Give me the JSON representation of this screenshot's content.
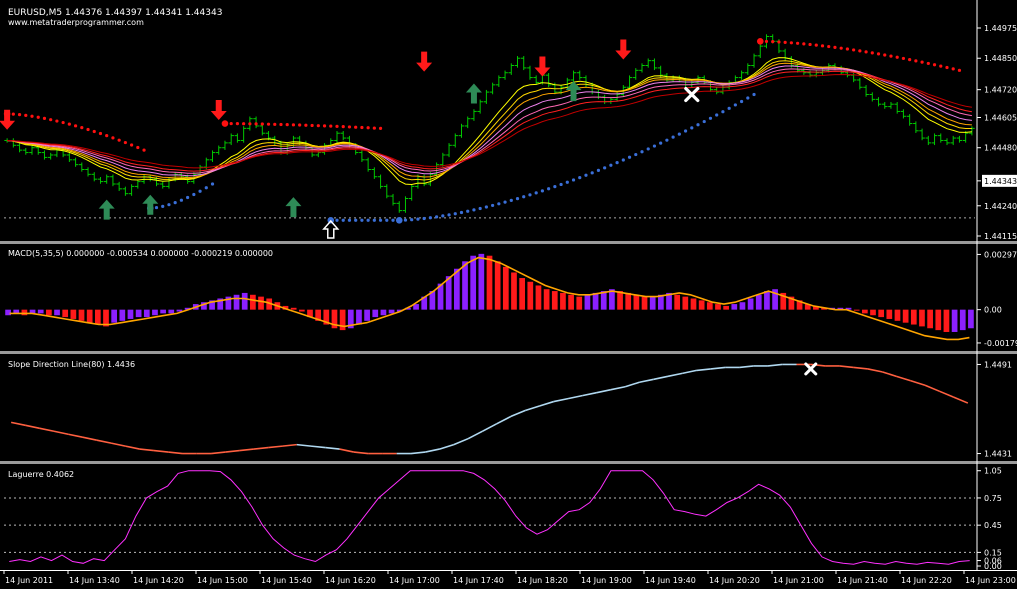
{
  "header": {
    "symbol_line": "EURUSD,M5  1.44376 1.44397 1.44341 1.44343",
    "watermark": "www.metatraderprogrammer.com"
  },
  "colors": {
    "background": "#000000",
    "bull_candle": "#00c800",
    "ma_colors": [
      "#ffff00",
      "#ffd700",
      "#ffa500",
      "#ee82ee",
      "#ff69b4",
      "#ff2020",
      "#c00000"
    ],
    "sar_red": "#ff1010",
    "sar_blue": "#3a6fd8",
    "up_arrow": "#2e8b57",
    "down_arrow": "#ff1a1a",
    "macd_up": "#8b20ff",
    "macd_down": "#ff1a1a",
    "macd_signal": "#ffa500",
    "slope_up": "#b0d8f0",
    "slope_down": "#ff6040",
    "laguerre": "#ff30ff",
    "cross_marker": "#ffffff"
  },
  "icons": {
    "buy_signal": "green-up-arrow-icon",
    "sell_signal": "red-down-arrow-icon",
    "exit": "white-x-icon",
    "entry": "white-hollow-up-arrow-icon"
  },
  "chart_data": [
    {
      "type": "line",
      "title": "EURUSD,M5  1.44376 1.44397 1.44341 1.44343",
      "ylim": [
        1.44115,
        1.44975
      ],
      "y_ticks": [
        "1.44975",
        "1.44850",
        "1.44720",
        "1.44605",
        "1.44480",
        "1.44343",
        "1.44240",
        "1.44115"
      ],
      "current_price": "1.44343",
      "series": [],
      "close": [
        1.4451,
        1.4449,
        1.4447,
        1.4446,
        1.4448,
        1.4446,
        1.4444,
        1.4445,
        1.4447,
        1.4445,
        1.4443,
        1.4441,
        1.4439,
        1.4437,
        1.4435,
        1.4434,
        1.4436,
        1.4433,
        1.4431,
        1.4429,
        1.4432,
        1.4434,
        1.4436,
        1.4435,
        1.4433,
        1.4432,
        1.4435,
        1.4437,
        1.4436,
        1.4434,
        1.4437,
        1.444,
        1.4443,
        1.4446,
        1.4448,
        1.445,
        1.4453,
        1.4451,
        1.4456,
        1.446,
        1.4457,
        1.4454,
        1.4452,
        1.445,
        1.4446,
        1.4449,
        1.4452,
        1.445,
        1.4448,
        1.4445,
        1.4446,
        1.4449,
        1.4451,
        1.4454,
        1.4452,
        1.4449,
        1.4446,
        1.4443,
        1.4439,
        1.4436,
        1.4432,
        1.4428,
        1.4425,
        1.4422,
        1.4427,
        1.4432,
        1.4436,
        1.4433,
        1.4437,
        1.4441,
        1.4445,
        1.4449,
        1.4453,
        1.4457,
        1.446,
        1.4463,
        1.4467,
        1.4471,
        1.4474,
        1.4477,
        1.4479,
        1.4482,
        1.4485,
        1.4481,
        1.4477,
        1.4475,
        1.4478,
        1.4474,
        1.4471,
        1.4473,
        1.4476,
        1.4479,
        1.4477,
        1.4474,
        1.4471,
        1.4469,
        1.4467,
        1.4468,
        1.447,
        1.4473,
        1.4477,
        1.448,
        1.4482,
        1.4484,
        1.4481,
        1.4478,
        1.4476,
        1.4477,
        1.4476,
        1.4474,
        1.4475,
        1.4477,
        1.4475,
        1.4472,
        1.4471,
        1.4473,
        1.4475,
        1.4477,
        1.4479,
        1.4482,
        1.4486,
        1.449,
        1.4494,
        1.4492,
        1.4488,
        1.4485,
        1.4482,
        1.448,
        1.4479,
        1.4478,
        1.4479,
        1.448,
        1.4482,
        1.4481,
        1.4479,
        1.4478,
        1.4476,
        1.4473,
        1.447,
        1.4468,
        1.4466,
        1.4465,
        1.4466,
        1.4463,
        1.4461,
        1.4458,
        1.4455,
        1.4452,
        1.445,
        1.4453,
        1.4451,
        1.445,
        1.4452,
        1.4451,
        1.4454,
        1.4456
      ],
      "buy_arrows": [
        [
          16,
          1.4422
        ],
        [
          23,
          1.4424
        ],
        [
          46,
          1.4423
        ],
        [
          75,
          1.447
        ],
        [
          91,
          1.4471
        ]
      ],
      "sell_arrows": [
        [
          0,
          1.446
        ],
        [
          34,
          1.4464
        ],
        [
          67,
          1.4484
        ],
        [
          86,
          1.4482
        ],
        [
          99,
          1.4489
        ]
      ],
      "entry_marker": [
        52,
        1.4414
      ],
      "exit_marker": [
        110,
        1.447
      ]
    },
    {
      "type": "bar",
      "title": "MACD(5,35,5) 0.000000 -0.000534 0.000000 -0.000219 0.000000",
      "ylim": [
        -0.0019,
        0.0031
      ],
      "y_ticks": [
        "0.00297",
        "0.00",
        "-0.00179"
      ],
      "histogram": [
        -0.0003,
        -0.0002,
        -0.0003,
        -0.0002,
        -0.0002,
        -0.0003,
        -0.0003,
        -0.0004,
        -0.0005,
        -0.0006,
        -0.0007,
        -0.0008,
        -0.0009,
        -0.0007,
        -0.0006,
        -0.0005,
        -0.0004,
        -0.0004,
        -0.0003,
        -0.0002,
        -0.0002,
        -0.0001,
        0.0001,
        0.0003,
        0.0004,
        0.0005,
        0.0006,
        0.0007,
        0.0008,
        0.0009,
        0.0008,
        0.0007,
        0.0006,
        0.0004,
        0.0002,
        0.0001,
        -0.0001,
        -0.0004,
        -0.0006,
        -0.0008,
        -0.001,
        -0.0011,
        -0.001,
        -0.0008,
        -0.0006,
        -0.0004,
        -0.0003,
        -0.0002,
        -0.0001,
        0.0001,
        0.0003,
        0.0007,
        0.001,
        0.0014,
        0.0018,
        0.0022,
        0.0026,
        0.0029,
        0.003,
        0.0029,
        0.0026,
        0.0023,
        0.002,
        0.0017,
        0.0015,
        0.0013,
        0.0011,
        0.001,
        0.0009,
        0.0008,
        0.0007,
        0.0008,
        0.0009,
        0.001,
        0.0011,
        0.001,
        0.0009,
        0.0008,
        0.0007,
        0.0007,
        0.0008,
        0.0009,
        0.0008,
        0.0007,
        0.0006,
        0.0005,
        0.0004,
        0.0003,
        0.0002,
        0.0003,
        0.0004,
        0.0006,
        0.0008,
        0.001,
        0.0011,
        0.0009,
        0.0007,
        0.0005,
        0.0003,
        0.0002,
        0.0001,
        0.0001,
        0.0001,
        0.0001,
        0.0,
        -0.0002,
        -0.0003,
        -0.0004,
        -0.0005,
        -0.0006,
        -0.0007,
        -0.0008,
        -0.0009,
        -0.001,
        -0.0011,
        -0.0012,
        -0.0012,
        -0.0011,
        -0.001
      ],
      "signal": [
        -0.0002,
        -0.0002,
        -0.0002,
        -0.0003,
        -0.0004,
        -0.0005,
        -0.0006,
        -0.0007,
        -0.0008,
        -0.0008,
        -0.0007,
        -0.0006,
        -0.0005,
        -0.0004,
        -0.0003,
        -0.0002,
        0.0,
        0.0002,
        0.0004,
        0.0005,
        0.0006,
        0.0006,
        0.0005,
        0.0004,
        0.0002,
        0.0,
        -0.0002,
        -0.0004,
        -0.0006,
        -0.0008,
        -0.0009,
        -0.0008,
        -0.0007,
        -0.0005,
        -0.0003,
        -0.0001,
        0.0002,
        0.0006,
        0.001,
        0.0015,
        0.002,
        0.0025,
        0.0028,
        0.0027,
        0.0025,
        0.0022,
        0.0019,
        0.0016,
        0.0013,
        0.0011,
        0.0009,
        0.0008,
        0.0008,
        0.0009,
        0.001,
        0.0009,
        0.0008,
        0.0007,
        0.0007,
        0.0008,
        0.0009,
        0.0008,
        0.0006,
        0.0004,
        0.0003,
        0.0004,
        0.0006,
        0.0008,
        0.001,
        0.0008,
        0.0006,
        0.0004,
        0.0002,
        0.0001,
        0.0,
        0.0,
        -0.0002,
        -0.0004,
        -0.0006,
        -0.0008,
        -0.001,
        -0.0012,
        -0.0014,
        -0.0015,
        -0.0016,
        -0.0016,
        -0.0015
      ]
    },
    {
      "type": "line",
      "title": "Slope Direction Line(80) 1.4436",
      "ylim": [
        1.4428,
        1.4494
      ],
      "y_ticks": [
        "1.4491",
        "1.4431"
      ],
      "values": [
        1.4452,
        1.445,
        1.4448,
        1.4446,
        1.4444,
        1.4442,
        1.444,
        1.4438,
        1.4436,
        1.4434,
        1.4433,
        1.4432,
        1.4431,
        1.4431,
        1.4431,
        1.4432,
        1.4433,
        1.4434,
        1.4435,
        1.4436,
        1.4437,
        1.4436,
        1.4435,
        1.4434,
        1.4432,
        1.4431,
        1.4431,
        1.4431,
        1.4431,
        1.4432,
        1.4434,
        1.4437,
        1.4441,
        1.4446,
        1.4451,
        1.4456,
        1.446,
        1.4463,
        1.4466,
        1.4468,
        1.447,
        1.4472,
        1.4474,
        1.4476,
        1.4479,
        1.4481,
        1.4483,
        1.4485,
        1.4487,
        1.4488,
        1.4489,
        1.4489,
        1.449,
        1.449,
        1.4491,
        1.4491,
        1.4491,
        1.449,
        1.449,
        1.4489,
        1.4488,
        1.4486,
        1.4483,
        1.448,
        1.4477,
        1.4473,
        1.4469,
        1.4465
      ],
      "up_segments": [
        [
          21,
          23
        ],
        [
          28,
          55
        ]
      ],
      "exit_marker": [
        56,
        1.4488
      ]
    },
    {
      "type": "line",
      "title": "Laguerre 0.4062",
      "ylim": [
        0.0,
        1.08
      ],
      "y_ticks": [
        "1.05",
        "0.75",
        "0.45",
        "0.15",
        "0.06",
        "0.00"
      ],
      "levels": [
        0.75,
        0.45,
        0.15
      ],
      "values": [
        0.05,
        0.07,
        0.05,
        0.1,
        0.06,
        0.12,
        0.05,
        0.03,
        0.08,
        0.06,
        0.18,
        0.3,
        0.55,
        0.75,
        0.82,
        0.88,
        1.02,
        1.05,
        1.05,
        1.05,
        1.04,
        0.95,
        0.82,
        0.65,
        0.45,
        0.3,
        0.2,
        0.12,
        0.08,
        0.05,
        0.12,
        0.18,
        0.3,
        0.45,
        0.6,
        0.75,
        0.85,
        0.95,
        1.05,
        1.05,
        1.05,
        1.05,
        1.05,
        1.05,
        1.02,
        0.95,
        0.85,
        0.72,
        0.55,
        0.42,
        0.35,
        0.4,
        0.5,
        0.6,
        0.62,
        0.7,
        0.85,
        1.05,
        1.05,
        1.05,
        1.05,
        0.95,
        0.8,
        0.62,
        0.6,
        0.57,
        0.55,
        0.62,
        0.7,
        0.75,
        0.82,
        0.9,
        0.85,
        0.78,
        0.65,
        0.45,
        0.25,
        0.1,
        0.05,
        0.03,
        0.02,
        0.05,
        0.03,
        0.02,
        0.05,
        0.03,
        0.02,
        0.04,
        0.03,
        0.02,
        0.05,
        0.06
      ]
    }
  ],
  "x_axis": {
    "labels": [
      "14 Jun 2011",
      "14 Jun 13:40",
      "14 Jun 14:20",
      "14 Jun 15:00",
      "14 Jun 15:40",
      "14 Jun 16:20",
      "14 Jun 17:00",
      "14 Jun 17:40",
      "14 Jun 18:20",
      "14 Jun 19:00",
      "14 Jun 19:40",
      "14 Jun 20:20",
      "14 Jun 21:00",
      "14 Jun 21:40",
      "14 Jun 22:20",
      "14 Jun 23:00"
    ]
  }
}
